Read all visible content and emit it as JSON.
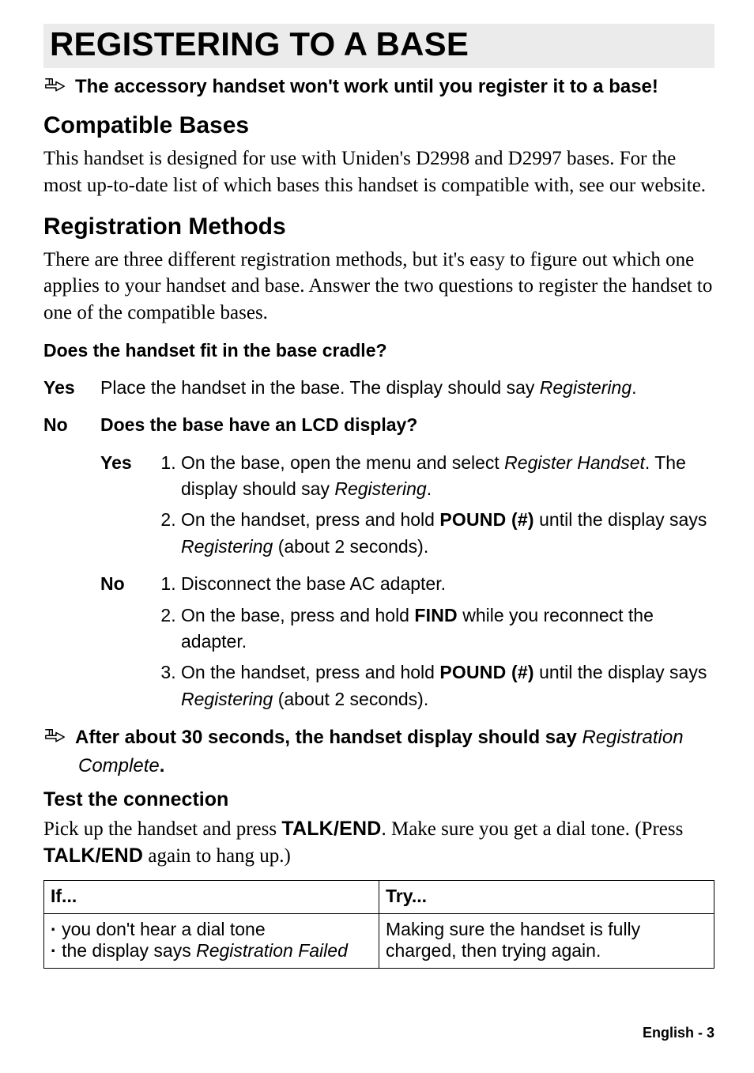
{
  "h1": "REGISTERING TO A BASE",
  "note1": "The accessory handset won't work until you register it to a base!",
  "sec1": {
    "title": "Compatible Bases",
    "body": "This handset is designed for use with Uniden's D2998 and D2997 bases. For the most up-to-date list of which bases this handset is compatible with, see our website."
  },
  "sec2": {
    "title": "Registration Methods",
    "body": "There are three different registration methods, but it's easy to figure out which one applies to your handset and base. Answer the two questions to register the handset to one of the compatible bases."
  },
  "q": {
    "q1": "Does the handset fit in the base cradle?",
    "yes": "Yes",
    "no": "No",
    "yes_body_pre": "Place the handset in the base. The display should say ",
    "yes_body_it": "Registering",
    "yes_body_post": ".",
    "q2": "Does the base have an LCD display?",
    "yes2": {
      "l1_pre": "On the base, open the menu and select ",
      "l1_it": "Register Handset",
      "l1_mid": ". The display should say ",
      "l1_it2": "Registering",
      "l1_post": ".",
      "l2_pre": "On the handset, press and hold ",
      "l2_key": "POUND (#)",
      "l2_mid": " until the display says ",
      "l2_it": "Registering",
      "l2_post": " (about 2 seconds)."
    },
    "no2": {
      "l1": "Disconnect the base AC adapter.",
      "l2_pre": "On the base, press and hold ",
      "l2_key": "FIND",
      "l2_post": " while you reconnect the adapter.",
      "l3_pre": "On the handset, press and hold ",
      "l3_key": "POUND (#)",
      "l3_mid": " until the display says ",
      "l3_it": "Registering",
      "l3_post": " (about 2 seconds)."
    }
  },
  "note2": {
    "bold": "After about 30 seconds, the handset display should say ",
    "it": "Registration",
    "line2_it": "Complete",
    "line2_post": "."
  },
  "test": {
    "title": "Test the connection",
    "pre": "Pick up the handset and press ",
    "k1": "TALK/END",
    "mid": ". Make sure you get a dial tone. (Press ",
    "k2": "TALK/END",
    "post": " again to hang up.)"
  },
  "table": {
    "h1": "If...",
    "h2": "Try...",
    "r1a": "you don't hear a dial tone",
    "r1b_pre": "the display says ",
    "r1b_it": "Registration Failed",
    "r1_try": "Making sure the handset is fully charged, then trying again."
  },
  "footer": "English - 3"
}
